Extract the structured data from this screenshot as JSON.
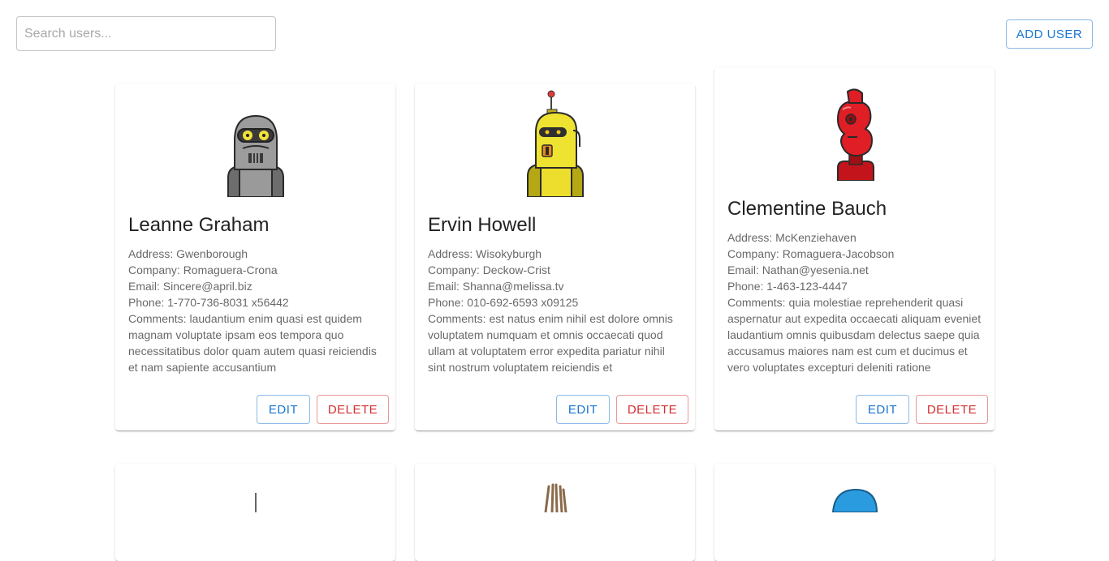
{
  "search": {
    "placeholder": "Search users...",
    "value": ""
  },
  "toolbar": {
    "add_user_label": "ADD USER"
  },
  "colors": {
    "primary": "#1976d2",
    "danger": "#d32f2f"
  },
  "users": [
    {
      "name": "Leanne Graham",
      "avatar_icon": "grey-robot-avatar-icon",
      "address": "Address: Gwenborough",
      "company": "Company: Romaguera-Crona",
      "email": "Email: Sincere@april.biz",
      "phone": "Phone: 1-770-736-8031 x56442",
      "comments": "Comments: laudantium enim quasi est quidem magnam voluptate ipsam eos tempora quo necessitatibus dolor quam autem quasi reiciendis et nam sapiente accusantium",
      "edit_label": "EDIT",
      "delete_label": "DELETE"
    },
    {
      "name": "Ervin Howell",
      "avatar_icon": "yellow-robot-avatar-icon",
      "address": "Address: Wisokyburgh",
      "company": "Company: Deckow-Crist",
      "email": "Email: Shanna@melissa.tv",
      "phone": "Phone: 010-692-6593 x09125",
      "comments": "Comments: est natus enim nihil est dolore omnis voluptatem numquam et omnis occaecati quod ullam at voluptatem error expedita pariatur nihil sint nostrum voluptatem reiciendis et",
      "edit_label": "EDIT",
      "delete_label": "DELETE"
    },
    {
      "name": "Clementine Bauch",
      "avatar_icon": "red-robot-avatar-icon",
      "address": "Address: McKenziehaven",
      "company": "Company: Romaguera-Jacobson",
      "email": "Email: Nathan@yesenia.net",
      "phone": "Phone: 1-463-123-4447",
      "comments": "Comments: quia molestiae reprehenderit quasi aspernatur aut expedita occaecati aliquam eveniet laudantium omnis quibusdam delectus saepe quia accusamus maiores nam est cum et ducimus et vero voluptates excepturi deleniti ratione",
      "edit_label": "EDIT",
      "delete_label": "DELETE"
    }
  ],
  "partial_cards": [
    {
      "avatar_icon": "robot-avatar-icon"
    },
    {
      "avatar_icon": "robot-avatar-icon"
    },
    {
      "avatar_icon": "robot-avatar-icon"
    }
  ]
}
